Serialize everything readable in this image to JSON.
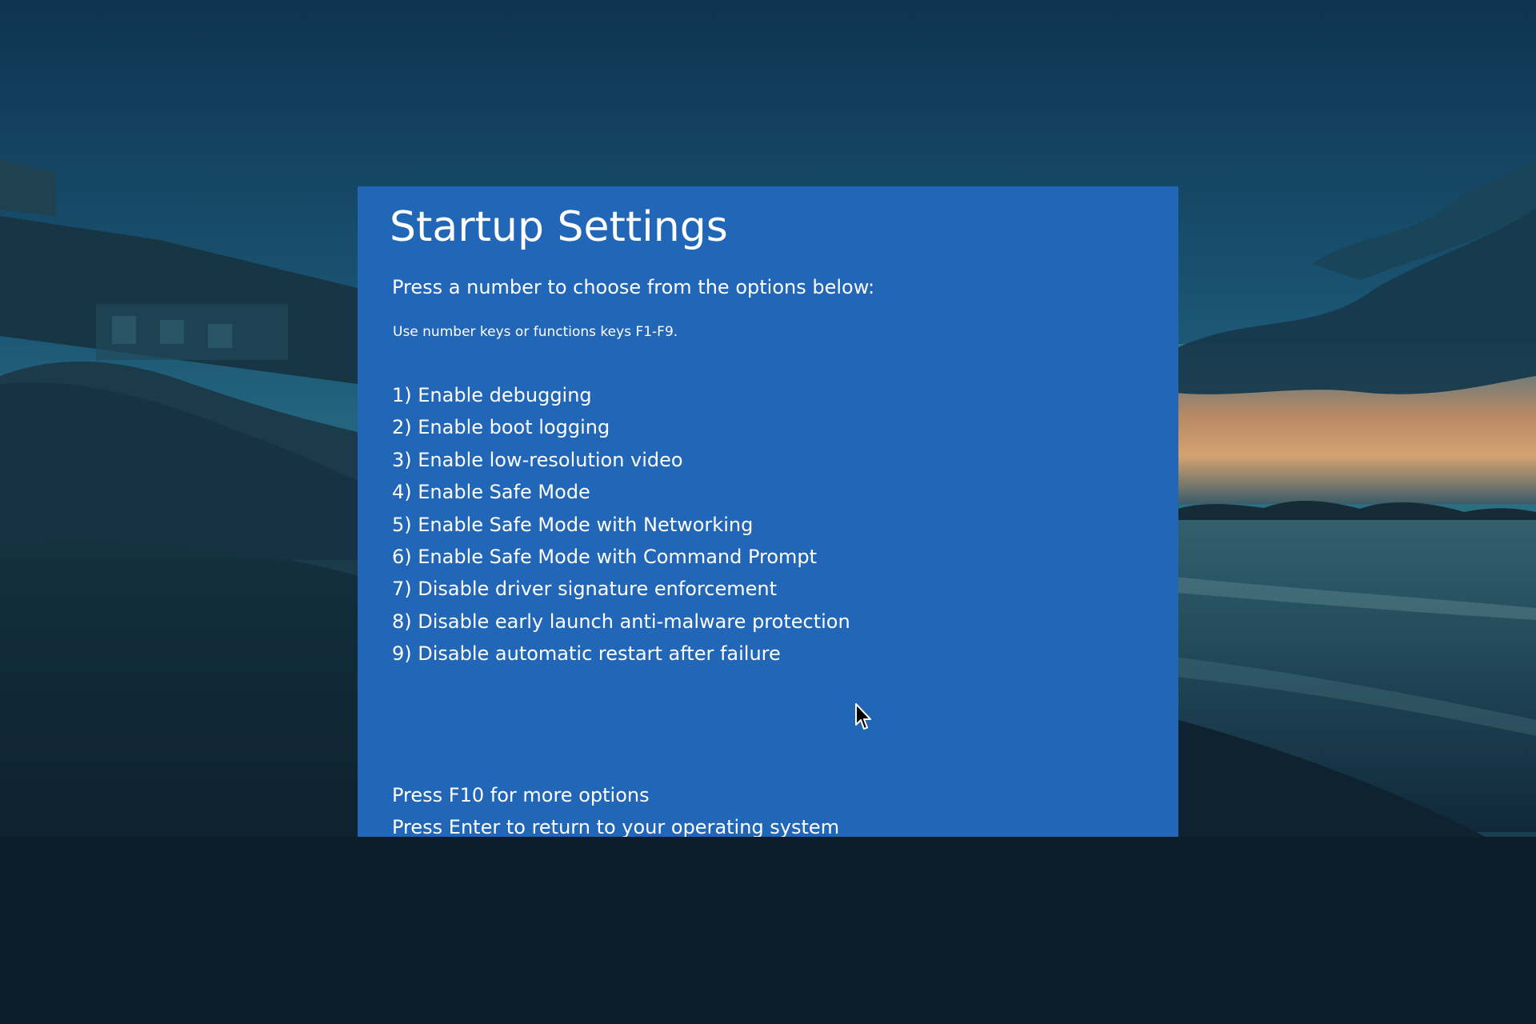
{
  "screen": {
    "title": "Startup Settings",
    "subtitle": "Press a number to choose from the options below:",
    "hint": "Use number keys or functions keys F1-F9.",
    "options": [
      {
        "label": "1) Enable debugging"
      },
      {
        "label": "2) Enable boot logging"
      },
      {
        "label": "3) Enable low-resolution video"
      },
      {
        "label": "4) Enable Safe Mode"
      },
      {
        "label": "5) Enable Safe Mode with Networking"
      },
      {
        "label": "6) Enable Safe Mode with Command Prompt"
      },
      {
        "label": "7) Disable driver signature enforcement"
      },
      {
        "label": "8) Disable early launch anti-malware protection"
      },
      {
        "label": "9) Disable automatic restart after failure"
      }
    ],
    "footer": {
      "more_options": "Press F10 for more options",
      "return": "Press Enter to return to your operating system"
    }
  },
  "colors": {
    "panel_background": "#2266b8",
    "text": "#ffffff"
  },
  "icons": {
    "cursor": "mouse-pointer-icon"
  }
}
